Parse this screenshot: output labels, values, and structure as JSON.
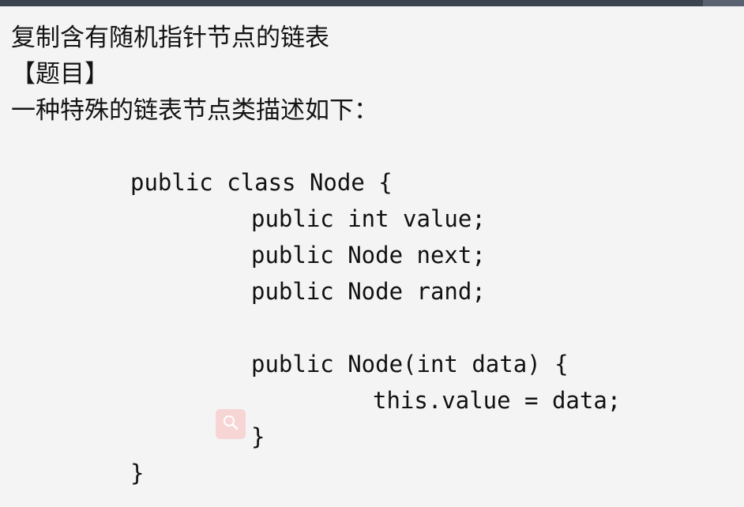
{
  "document": {
    "title": "复制含有随机指针节点的链表",
    "section_label": "【题目】",
    "description": "一种特殊的链表节点类描述如下："
  },
  "code": {
    "lines": [
      "public class Node {",
      "public int value;",
      "public Node next;",
      "public Node rand;",
      "public Node(int data) {",
      "this.value = data;",
      "}",
      "}"
    ]
  },
  "overlay": {
    "icon": "search-icon",
    "color": "#f8c8c8"
  },
  "colors": {
    "top_bar": "#3b4250",
    "background": "#f4f4f4",
    "text": "#111111"
  }
}
